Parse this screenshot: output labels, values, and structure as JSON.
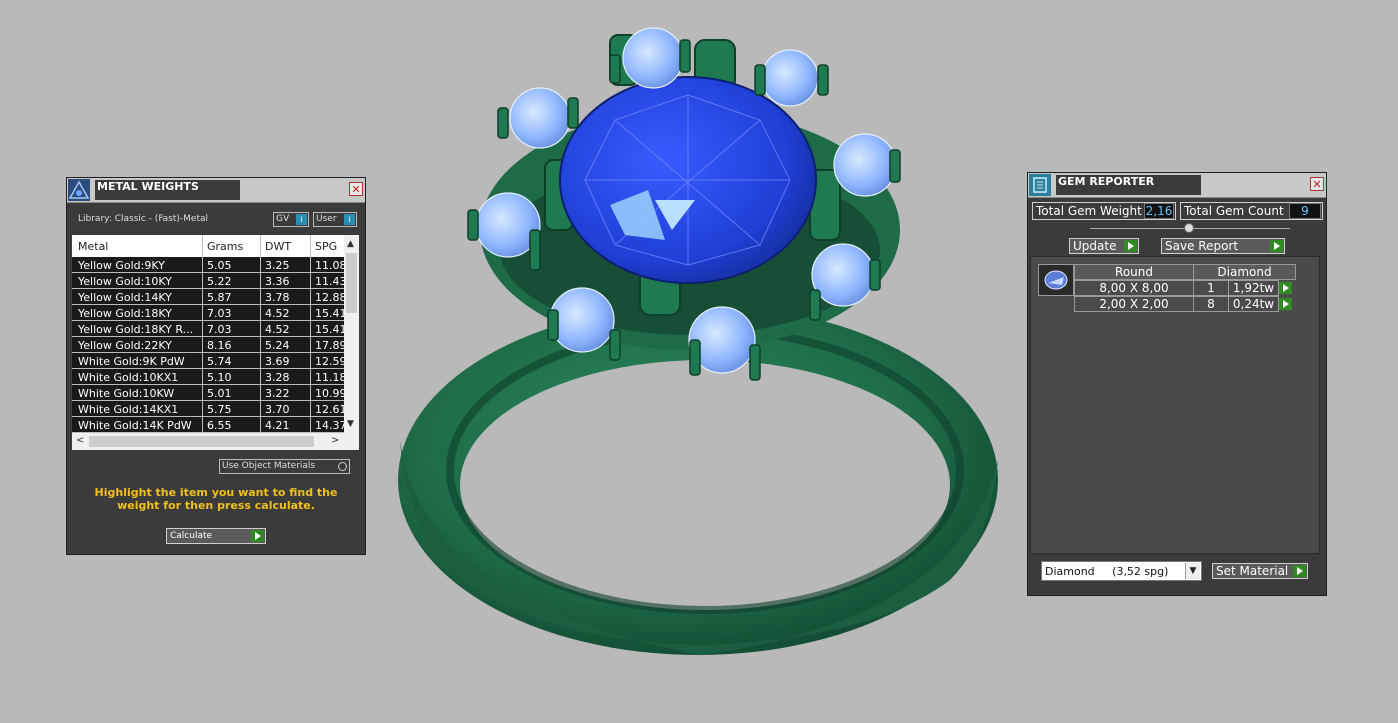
{
  "metal_weights": {
    "title": "METAL WEIGHTS",
    "library": "Library: Classic - (Fast)-Metal",
    "gv_label": "GV",
    "user_label": "User",
    "columns": [
      "Metal",
      "Grams",
      "DWT",
      "SPG"
    ],
    "rows": [
      {
        "metal": "Yellow Gold:9KY",
        "grams": "5.05",
        "dwt": "3.25",
        "spg": "11.08"
      },
      {
        "metal": "Yellow Gold:10KY",
        "grams": "5.22",
        "dwt": "3.36",
        "spg": "11.43"
      },
      {
        "metal": "Yellow Gold:14KY",
        "grams": "5.87",
        "dwt": "3.78",
        "spg": "12.88"
      },
      {
        "metal": "Yellow Gold:18KY",
        "grams": "7.03",
        "dwt": "4.52",
        "spg": "15.41"
      },
      {
        "metal": "Yellow Gold:18KY R...",
        "grams": "7.03",
        "dwt": "4.52",
        "spg": "15.41"
      },
      {
        "metal": "Yellow Gold:22KY",
        "grams": "8.16",
        "dwt": "5.24",
        "spg": "17.89"
      },
      {
        "metal": "White Gold:9K PdW",
        "grams": "5.74",
        "dwt": "3.69",
        "spg": "12.59"
      },
      {
        "metal": "White Gold:10KX1",
        "grams": "5.10",
        "dwt": "3.28",
        "spg": "11.18"
      },
      {
        "metal": "White Gold:10KW",
        "grams": "5.01",
        "dwt": "3.22",
        "spg": "10.99"
      },
      {
        "metal": "White Gold:14KX1",
        "grams": "5.75",
        "dwt": "3.70",
        "spg": "12.61"
      },
      {
        "metal": "White Gold:14K PdW",
        "grams": "6.55",
        "dwt": "4.21",
        "spg": "14.37"
      }
    ],
    "use_object_materials": "Use Object Materials",
    "hint": "Highlight the item you want to find the weight for then press calculate.",
    "calculate_label": "Calculate"
  },
  "gem_reporter": {
    "title": "GEM REPORTER",
    "total_gem_weight_label": "Total Gem Weight",
    "total_gem_weight_value": "2,16",
    "total_gem_count_label": "Total Gem Count",
    "total_gem_count_value": "9",
    "update_label": "Update",
    "save_report_label": "Save Report",
    "gem_headers": [
      "Round",
      "Diamond"
    ],
    "gems": [
      {
        "size": "8,00 X 8,00",
        "count": "1",
        "weight": "1,92tw"
      },
      {
        "size": "2,00 X 2,00",
        "count": "8",
        "weight": "0,24tw"
      }
    ],
    "material_select": "Diamond     (3,52 spg)",
    "set_material_label": "Set Material"
  },
  "colors": {
    "metal": "#1e6b48",
    "center_stone": "#1f3fd6",
    "side_stones": "#8fb8ff",
    "background": "#b9b9b9"
  }
}
